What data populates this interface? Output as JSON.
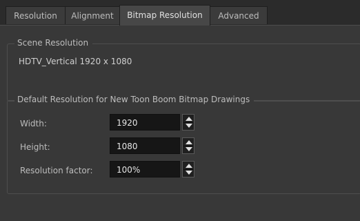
{
  "tabs": [
    {
      "label": "Resolution",
      "active": false
    },
    {
      "label": "Alignment",
      "active": false
    },
    {
      "label": "Bitmap Resolution",
      "active": true
    },
    {
      "label": "Advanced",
      "active": false
    }
  ],
  "scene_resolution": {
    "title": "Scene Resolution",
    "value": "HDTV_Vertical  1920 x 1080"
  },
  "default_resolution": {
    "title": "Default Resolution for New Toon Boom Bitmap Drawings",
    "width_label": "Width:",
    "width_value": "1920",
    "height_label": "Height:",
    "height_value": "1080",
    "factor_label": "Resolution factor:",
    "factor_value": "100%"
  },
  "colors": {
    "panel_bg": "#383838",
    "field_bg": "#161616",
    "active_tab": "#474747"
  }
}
